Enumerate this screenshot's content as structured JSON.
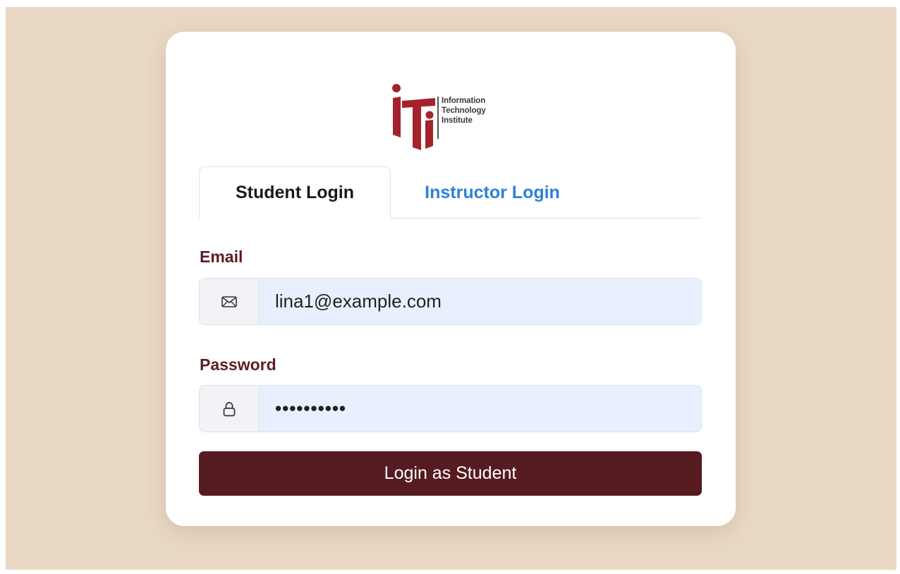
{
  "logo": {
    "line1": "Information",
    "line2": "Technology",
    "line3": "Institute",
    "brand_color": "#a3232c"
  },
  "tabs": [
    {
      "label": "Student Login",
      "active": true
    },
    {
      "label": "Instructor Login",
      "active": false
    }
  ],
  "form": {
    "email": {
      "label": "Email",
      "icon": "envelope-icon",
      "value": "lina1@example.com"
    },
    "password": {
      "label": "Password",
      "icon": "lock-icon",
      "value": "••••••••••"
    },
    "submit_label": "Login as Student"
  },
  "colors": {
    "background": "#e9d8c3",
    "label": "#5c1e24",
    "button": "#551b21",
    "link_tab": "#2f80d8",
    "input_fill": "#e8f0fe"
  }
}
